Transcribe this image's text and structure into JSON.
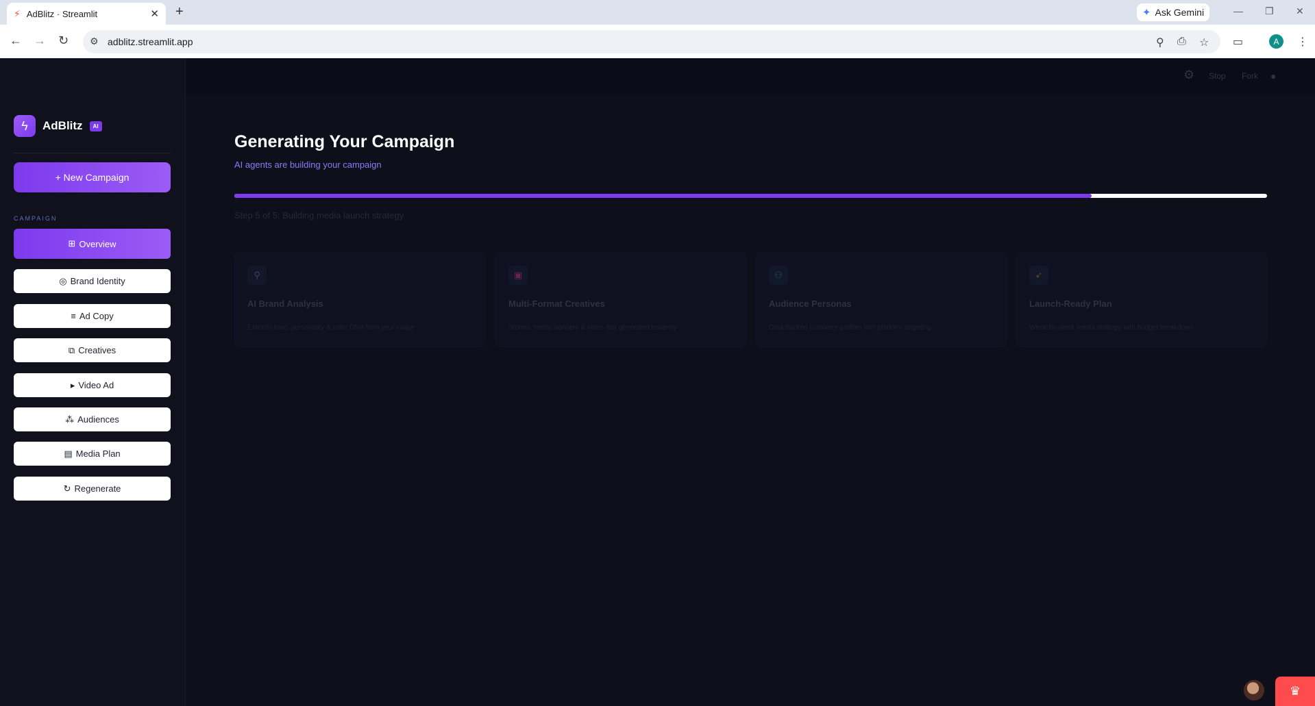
{
  "browser": {
    "tab_title": "AdBlitz · Streamlit",
    "tab_favicon": "streamlit-icon",
    "new_tab_label": "+",
    "gemini_label": "Ask Gemini",
    "url": "adblitz.streamlit.app",
    "profile_initial": "A"
  },
  "header": {
    "stop_label": "Stop",
    "fork_label": "Fork"
  },
  "sidebar": {
    "brand_name": "AdBlitz",
    "brand_badge": "AI",
    "new_campaign_label": "+ New Campaign",
    "section_label": "CAMPAIGN",
    "items": [
      {
        "icon": "⊞",
        "label": "Overview",
        "active": true
      },
      {
        "icon": "◎",
        "label": "Brand Identity"
      },
      {
        "icon": "≡",
        "label": "Ad Copy"
      },
      {
        "icon": "⧉",
        "label": "Creatives"
      },
      {
        "icon": "▸",
        "label": "Video Ad"
      },
      {
        "icon": "⁂",
        "label": "Audiences"
      },
      {
        "icon": "▤",
        "label": "Media Plan"
      },
      {
        "icon": "↻",
        "label": "Regenerate"
      }
    ]
  },
  "main": {
    "title": "Generating Your Campaign",
    "subtitle": "AI agents are building your campaign",
    "progress": 0.83,
    "step_text": "Step 5 of 5: Building media launch strategy",
    "cards": [
      {
        "icon": "search-icon",
        "glyph": "⚲",
        "color": "#3a3f66",
        "title": "AI Brand Analysis",
        "desc": "Extracts tone, personality & color DNA from your image"
      },
      {
        "icon": "layout-icon",
        "glyph": "▣",
        "color": "#6b2448",
        "title": "Multi-Format Creatives",
        "desc": "Stories, feeds, banners & video ads generated instantly"
      },
      {
        "icon": "users-icon",
        "glyph": "⚇",
        "color": "#1d5550",
        "title": "Audience Personas",
        "desc": "Data-backed customer profiles with platform targeting"
      },
      {
        "icon": "rocket-icon",
        "glyph": "➶",
        "color": "#6b4422",
        "title": "Launch-Ready Plan",
        "desc": "Week-by-week media strategy with budget breakdown"
      }
    ]
  }
}
